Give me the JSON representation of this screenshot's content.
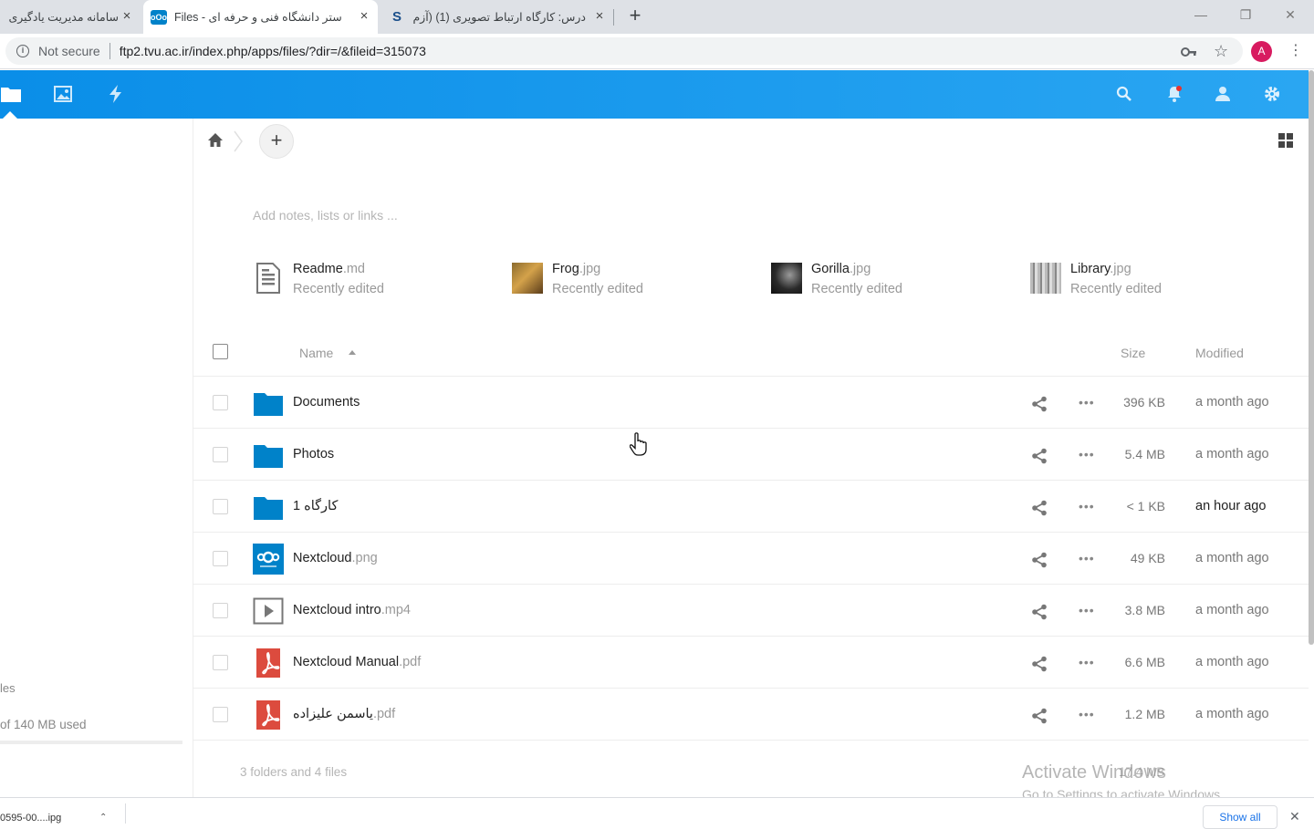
{
  "browser": {
    "tabs": [
      {
        "title": "سامانه مدیریت یادگیری",
        "favicon": "lms-favicon",
        "active": false
      },
      {
        "title": "Files - ستر دانشگاه فنی و حرفه ای",
        "favicon": "nextcloud-favicon",
        "active": true
      },
      {
        "title": "درس: کارگاه ارتباط تصویری (1) (آزم",
        "favicon": "moodle-favicon",
        "active": false
      }
    ],
    "security_label": "Not secure",
    "url": "ftp2.tvu.ac.ir/index.php/apps/files/?dir=/&fileid=315073",
    "profile_initial": "A"
  },
  "header": {
    "apps": [
      "files-icon",
      "photos-icon",
      "activity-icon"
    ],
    "right_icons": [
      "search-icon",
      "notifications-icon",
      "contacts-icon",
      "settings-icon"
    ],
    "accent_color": "#0082c9"
  },
  "sidebar": {
    "files_label": "les",
    "quota_text": "of 140 MB used",
    "quota_fraction": 0.0
  },
  "main": {
    "notes_placeholder": "Add notes, lists or links ...",
    "recent": [
      {
        "name": "Readme",
        "ext": ".md",
        "subtitle": "Recently edited",
        "thumb": "text-file-icon"
      },
      {
        "name": "Frog",
        "ext": ".jpg",
        "subtitle": "Recently edited",
        "thumb": "frog-thumbnail"
      },
      {
        "name": "Gorilla",
        "ext": ".jpg",
        "subtitle": "Recently edited",
        "thumb": "gorilla-thumbnail"
      },
      {
        "name": "Library",
        "ext": ".jpg",
        "subtitle": "Recently edited",
        "thumb": "library-thumbnail"
      }
    ],
    "columns": {
      "name": "Name",
      "size": "Size",
      "modified": "Modified"
    },
    "files": [
      {
        "name": "Documents",
        "ext": "",
        "type": "folder",
        "size": "396 KB",
        "modified": "a month ago"
      },
      {
        "name": "Photos",
        "ext": "",
        "type": "folder",
        "size": "5.4 MB",
        "modified": "a month ago"
      },
      {
        "name": "کارگاه 1",
        "ext": "",
        "type": "folder",
        "size": "< 1 KB",
        "modified": "an hour ago"
      },
      {
        "name": "Nextcloud",
        "ext": ".png",
        "type": "nextcloud-image",
        "size": "49 KB",
        "modified": "a month ago"
      },
      {
        "name": "Nextcloud intro",
        "ext": ".mp4",
        "type": "video",
        "size": "3.8 MB",
        "modified": "a month ago"
      },
      {
        "name": "Nextcloud Manual",
        "ext": ".pdf",
        "type": "pdf",
        "size": "6.6 MB",
        "modified": "a month ago"
      },
      {
        "name": "یاسمن علیزاده",
        "ext": ".pdf",
        "type": "pdf",
        "size": "1.2 MB",
        "modified": "a month ago"
      }
    ],
    "summary": "3 folders and 4 files",
    "summary_size": "17.4 MB"
  },
  "overlay": {
    "watermark_title": "Activate Windows",
    "watermark_sub": "Go to Settings to activate Windows."
  },
  "downloads": {
    "item": "0595-00....ipg",
    "show_all": "Show all"
  }
}
